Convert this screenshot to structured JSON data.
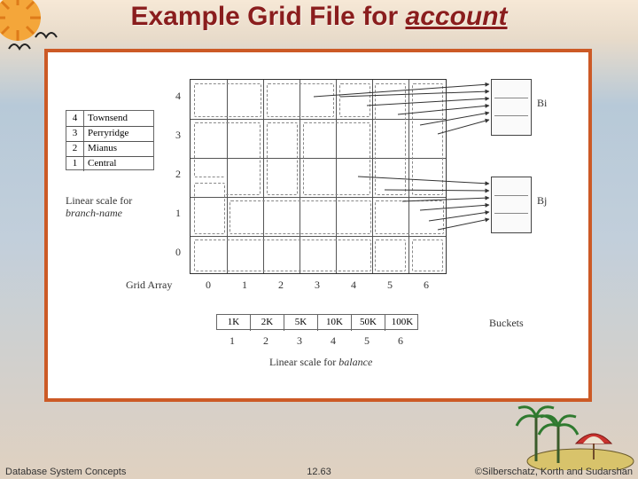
{
  "title": {
    "prefix": "Example Grid File for ",
    "subject": "account"
  },
  "branch_scale": {
    "label_line1": "Linear scale for",
    "label_line2": "branch-name",
    "entries": [
      {
        "idx": "4",
        "name": "Townsend"
      },
      {
        "idx": "3",
        "name": "Perryridge"
      },
      {
        "idx": "2",
        "name": "Mianus"
      },
      {
        "idx": "1",
        "name": "Central"
      }
    ]
  },
  "balance_scale": {
    "label": "Linear scale for ",
    "label_ital": "balance",
    "values": [
      "1K",
      "2K",
      "5K",
      "10K",
      "50K",
      "100K"
    ],
    "indices": [
      "1",
      "2",
      "3",
      "4",
      "5",
      "6"
    ]
  },
  "grid": {
    "label": "Grid Array",
    "col_labels": [
      "0",
      "1",
      "2",
      "3",
      "4",
      "5",
      "6"
    ],
    "row_labels": [
      "4",
      "3",
      "2",
      "1",
      "0"
    ]
  },
  "buckets": {
    "label": "Buckets",
    "names": [
      "Bi",
      "Bj"
    ]
  },
  "footer": {
    "left": "Database System Concepts",
    "center": "12.63",
    "right": "©Silberschatz, Korth and Sudarshan"
  }
}
